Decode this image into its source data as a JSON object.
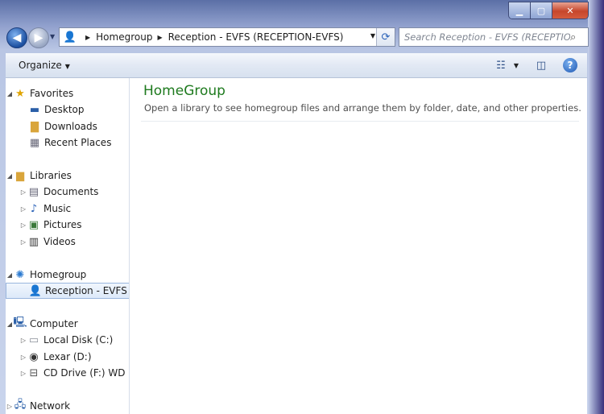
{
  "address_bar": {
    "breadcrumbs": [
      "Homegroup",
      "Reception - EVFS (RECEPTION-EVFS)"
    ]
  },
  "search": {
    "placeholder": "Search Reception - EVFS (RECEPTION-..."
  },
  "toolbar": {
    "organize_label": "Organize"
  },
  "nav": {
    "favorites": {
      "label": "Favorites",
      "items": [
        "Desktop",
        "Downloads",
        "Recent Places"
      ]
    },
    "libraries": {
      "label": "Libraries",
      "items": [
        "Documents",
        "Music",
        "Pictures",
        "Videos"
      ]
    },
    "homegroup": {
      "label": "Homegroup",
      "items": [
        "Reception - EVFS (RECEPTION-EVFS)"
      ]
    },
    "computer": {
      "label": "Computer",
      "items": [
        "Local Disk (C:)",
        "Lexar (D:)",
        "CD Drive (F:) WD Unlocker"
      ]
    },
    "network": {
      "label": "Network"
    }
  },
  "main": {
    "title": "HomeGroup",
    "description": "Open a library to see homegroup files and arrange them by folder, date, and other properties."
  },
  "colors": {
    "title_green": "#1e7a1e",
    "selection_blue": "#dce9f9"
  }
}
